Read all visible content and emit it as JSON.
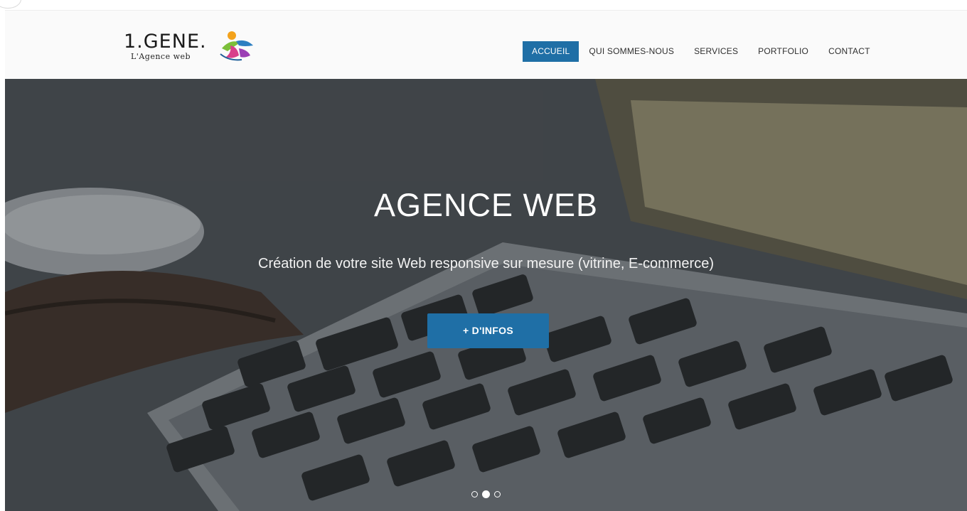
{
  "logo": {
    "main_text": "1.GENE.",
    "sub_text": "L'Agence web"
  },
  "nav": {
    "items": [
      {
        "label": "ACCUEIL",
        "active": true
      },
      {
        "label": "QUI SOMMES-NOUS",
        "active": false
      },
      {
        "label": "SERVICES",
        "active": false
      },
      {
        "label": "PORTFOLIO",
        "active": false
      },
      {
        "label": "CONTACT",
        "active": false
      }
    ]
  },
  "hero": {
    "title": "AGENCE WEB",
    "subtitle": "Création de votre site Web responsive sur mesure (vitrine, E-commerce)",
    "button_label": "+ D'INFOS",
    "slides_total": 3,
    "active_slide": 2,
    "background_image": "laptop-keyboard-photo"
  },
  "colors": {
    "accent": "#1f6fa6",
    "header_bg": "#fafafa",
    "nav_text": "#2f2f2f",
    "hero_text": "#ffffff"
  }
}
